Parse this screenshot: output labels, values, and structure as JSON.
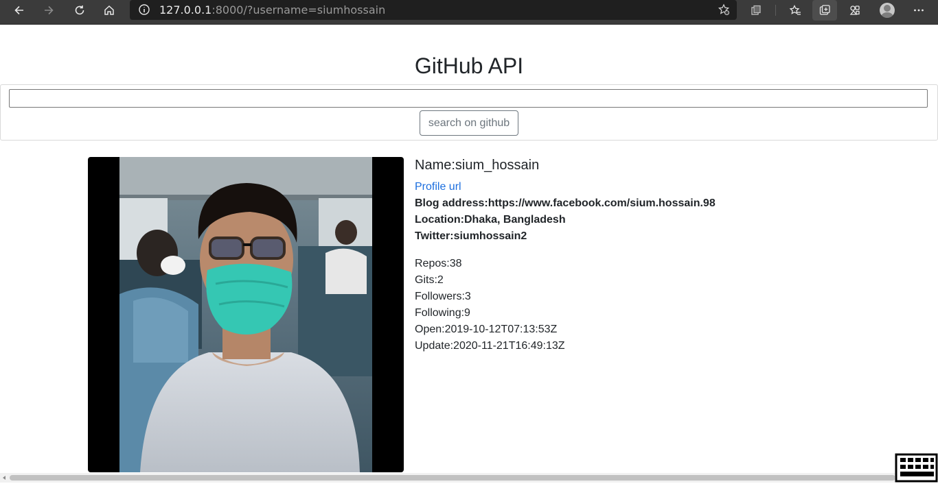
{
  "browser": {
    "url_host": "127.0.0.1",
    "url_rest": ":8000/?username=siumhossain"
  },
  "page": {
    "title": "GitHub API",
    "search": {
      "value": "",
      "placeholder": "",
      "button_label": "search on github"
    }
  },
  "profile": {
    "name_line": "Name:sium_hossain",
    "profile_link": "Profile url",
    "blog_line": "Blog address:https://www.facebook.com/sium.hossain.98",
    "location_line": "Location:Dhaka, Bangladesh",
    "twitter_line": "Twitter:siumhossain2",
    "stats": [
      "Repos:38",
      "Gits:2",
      "Followers:3",
      "Following:9",
      "Open:2019-10-12T07:13:53Z",
      "Update:2020-11-21T16:49:13Z"
    ]
  },
  "colors": {
    "link": "#1a6dde",
    "toolbar": "#3b3b3b",
    "button_border": "#6c757d"
  },
  "icons": [
    "back-icon",
    "forward-icon",
    "refresh-icon",
    "home-icon",
    "info-icon",
    "add-favorite-icon",
    "collections-icon",
    "favorites-icon",
    "tab-actions-icon",
    "extensions-icon",
    "profile-icon",
    "more-icon",
    "keyboard-icon"
  ]
}
